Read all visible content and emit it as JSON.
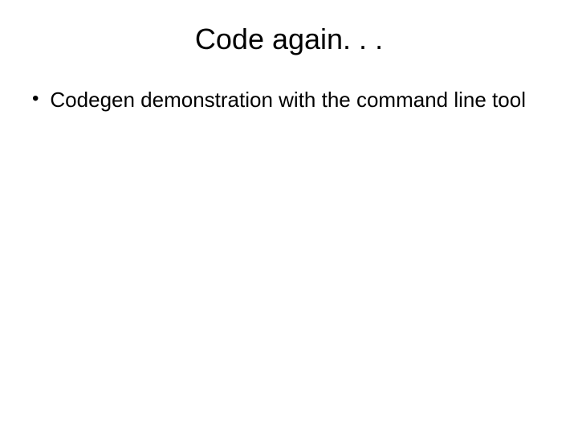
{
  "slide": {
    "title": "Code again. . .",
    "bullets": [
      {
        "text": "Codegen demonstration with the command line tool"
      }
    ]
  }
}
